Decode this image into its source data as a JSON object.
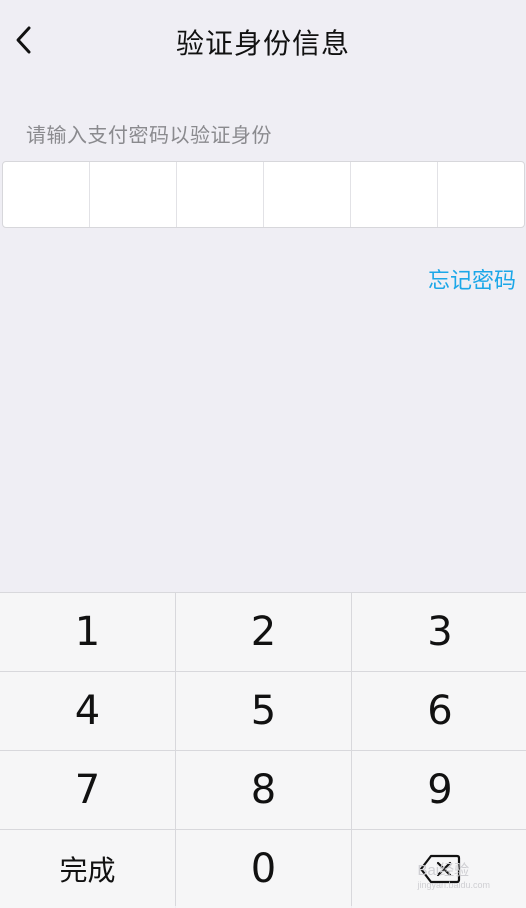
{
  "nav": {
    "back_icon": "chevron-left-icon",
    "title": "验证身份信息"
  },
  "prompt": "请输入支付密码以验证身份",
  "pin": {
    "length": 6,
    "filled": 0
  },
  "forgot_password": "忘记密码",
  "keypad": {
    "keys": [
      "1",
      "2",
      "3",
      "4",
      "5",
      "6",
      "7",
      "8",
      "9"
    ],
    "done_label": "完成",
    "zero": "0",
    "delete_icon": "backspace-icon"
  },
  "watermark": {
    "text": "Bai经验",
    "url": "jingyan.baidu.com"
  },
  "colors": {
    "background": "#efeef4",
    "accent": "#1ba7e8",
    "key_background": "#f6f6f7"
  }
}
